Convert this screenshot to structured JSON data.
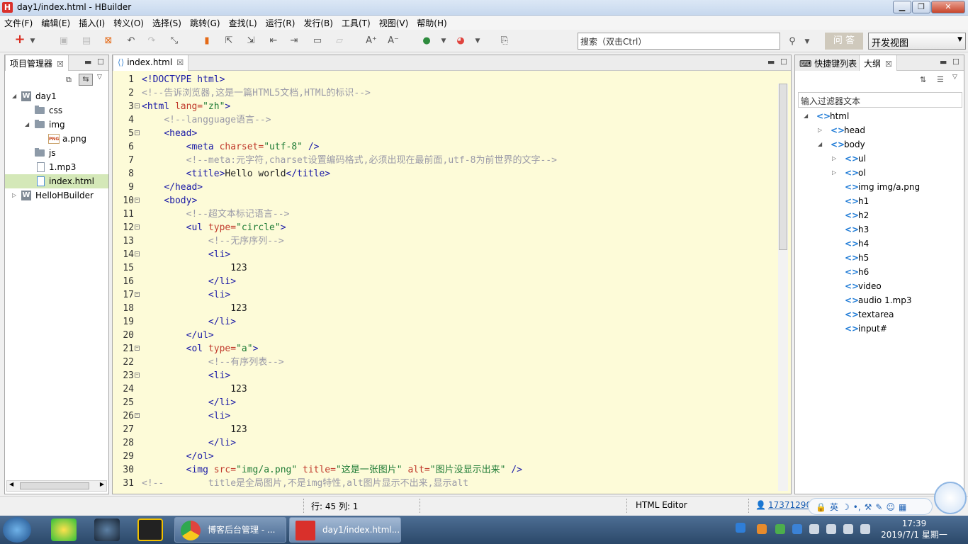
{
  "window": {
    "title": "day1/index.html  - HBuilder",
    "app_icon": "H"
  },
  "menu": [
    "文件(F)",
    "编辑(E)",
    "插入(I)",
    "转义(O)",
    "选择(S)",
    "跳转(G)",
    "查找(L)",
    "运行(R)",
    "发行(B)",
    "工具(T)",
    "视图(V)",
    "帮助(H)"
  ],
  "toolbar": {
    "search_placeholder": "搜索（双击Ctrl）",
    "ask_label": "问 答",
    "view_select": "开发视图"
  },
  "project_panel": {
    "tab": "项目管理器",
    "tree": [
      {
        "label": "day1",
        "type": "project",
        "depth": 0,
        "expanded": true
      },
      {
        "label": "css",
        "type": "folder",
        "depth": 1
      },
      {
        "label": "img",
        "type": "folder",
        "depth": 1,
        "expanded": true
      },
      {
        "label": "a.png",
        "type": "png",
        "depth": 2
      },
      {
        "label": "js",
        "type": "folder",
        "depth": 1
      },
      {
        "label": "1.mp3",
        "type": "file",
        "depth": 1
      },
      {
        "label": "index.html",
        "type": "html",
        "depth": 1,
        "selected": true
      },
      {
        "label": "HelloHBuilder",
        "type": "project",
        "depth": 0,
        "collapsed": true
      }
    ]
  },
  "editor": {
    "tab": "index.html",
    "lines": [
      {
        "n": "1",
        "tokens": [
          {
            "t": "tag",
            "v": "<!DOCTYPE html>"
          }
        ]
      },
      {
        "n": "2",
        "tokens": [
          {
            "t": "cmt",
            "v": "<!--告诉浏览器,这是一篇HTML5文档,HTML的标识-->"
          }
        ]
      },
      {
        "n": "3",
        "fold": true,
        "tokens": [
          {
            "t": "tag",
            "v": "<html "
          },
          {
            "t": "attr",
            "v": "lang="
          },
          {
            "t": "val",
            "v": "\"zh\""
          },
          {
            "t": "tag",
            "v": ">"
          }
        ]
      },
      {
        "n": "4",
        "tokens": [
          {
            "t": "txt",
            "v": "    "
          },
          {
            "t": "cmt",
            "v": "<!--langguage语言-->"
          }
        ]
      },
      {
        "n": "5",
        "fold": true,
        "tokens": [
          {
            "t": "txt",
            "v": "    "
          },
          {
            "t": "tag",
            "v": "<head>"
          }
        ]
      },
      {
        "n": "6",
        "tokens": [
          {
            "t": "txt",
            "v": "        "
          },
          {
            "t": "tag",
            "v": "<meta "
          },
          {
            "t": "attr",
            "v": "charset="
          },
          {
            "t": "val",
            "v": "\"utf-8\""
          },
          {
            "t": "tag",
            "v": " />"
          }
        ]
      },
      {
        "n": "7",
        "tokens": [
          {
            "t": "txt",
            "v": "        "
          },
          {
            "t": "cmt",
            "v": "<!--meta:元字符,charset设置编码格式,必须出现在最前面,utf-8为前世界的文字-->"
          }
        ]
      },
      {
        "n": "8",
        "tokens": [
          {
            "t": "txt",
            "v": "        "
          },
          {
            "t": "tag",
            "v": "<title>"
          },
          {
            "t": "txt",
            "v": "Hello world"
          },
          {
            "t": "tag",
            "v": "</title>"
          }
        ]
      },
      {
        "n": "9",
        "tokens": [
          {
            "t": "txt",
            "v": "    "
          },
          {
            "t": "tag",
            "v": "</head>"
          }
        ]
      },
      {
        "n": "10",
        "fold": true,
        "tokens": [
          {
            "t": "txt",
            "v": "    "
          },
          {
            "t": "tag",
            "v": "<body>"
          }
        ]
      },
      {
        "n": "11",
        "tokens": [
          {
            "t": "txt",
            "v": "        "
          },
          {
            "t": "cmt",
            "v": "<!--超文本标记语言-->"
          }
        ]
      },
      {
        "n": "12",
        "fold": true,
        "tokens": [
          {
            "t": "txt",
            "v": "        "
          },
          {
            "t": "tag",
            "v": "<ul "
          },
          {
            "t": "attr",
            "v": "type="
          },
          {
            "t": "val",
            "v": "\"circle\""
          },
          {
            "t": "tag",
            "v": ">"
          }
        ]
      },
      {
        "n": "13",
        "tokens": [
          {
            "t": "txt",
            "v": "            "
          },
          {
            "t": "cmt",
            "v": "<!--无序序列-->"
          }
        ]
      },
      {
        "n": "14",
        "fold": true,
        "tokens": [
          {
            "t": "txt",
            "v": "            "
          },
          {
            "t": "tag",
            "v": "<li>"
          }
        ]
      },
      {
        "n": "15",
        "tokens": [
          {
            "t": "txt",
            "v": "                123"
          }
        ]
      },
      {
        "n": "16",
        "tokens": [
          {
            "t": "txt",
            "v": "            "
          },
          {
            "t": "tag",
            "v": "</li>"
          }
        ]
      },
      {
        "n": "17",
        "fold": true,
        "tokens": [
          {
            "t": "txt",
            "v": "            "
          },
          {
            "t": "tag",
            "v": "<li>"
          }
        ]
      },
      {
        "n": "18",
        "tokens": [
          {
            "t": "txt",
            "v": "                123"
          }
        ]
      },
      {
        "n": "19",
        "tokens": [
          {
            "t": "txt",
            "v": "            "
          },
          {
            "t": "tag",
            "v": "</li>"
          }
        ]
      },
      {
        "n": "20",
        "tokens": [
          {
            "t": "txt",
            "v": "        "
          },
          {
            "t": "tag",
            "v": "</ul>"
          }
        ]
      },
      {
        "n": "21",
        "fold": true,
        "tokens": [
          {
            "t": "txt",
            "v": "        "
          },
          {
            "t": "tag",
            "v": "<ol "
          },
          {
            "t": "attr",
            "v": "type="
          },
          {
            "t": "val",
            "v": "\"a\""
          },
          {
            "t": "tag",
            "v": ">"
          }
        ]
      },
      {
        "n": "22",
        "tokens": [
          {
            "t": "txt",
            "v": "            "
          },
          {
            "t": "cmt",
            "v": "<!--有序列表-->"
          }
        ]
      },
      {
        "n": "23",
        "fold": true,
        "tokens": [
          {
            "t": "txt",
            "v": "            "
          },
          {
            "t": "tag",
            "v": "<li>"
          }
        ]
      },
      {
        "n": "24",
        "tokens": [
          {
            "t": "txt",
            "v": "                123"
          }
        ]
      },
      {
        "n": "25",
        "tokens": [
          {
            "t": "txt",
            "v": "            "
          },
          {
            "t": "tag",
            "v": "</li>"
          }
        ]
      },
      {
        "n": "26",
        "fold": true,
        "tokens": [
          {
            "t": "txt",
            "v": "            "
          },
          {
            "t": "tag",
            "v": "<li>"
          }
        ]
      },
      {
        "n": "27",
        "tokens": [
          {
            "t": "txt",
            "v": "                123"
          }
        ]
      },
      {
        "n": "28",
        "tokens": [
          {
            "t": "txt",
            "v": "            "
          },
          {
            "t": "tag",
            "v": "</li>"
          }
        ]
      },
      {
        "n": "29",
        "tokens": [
          {
            "t": "txt",
            "v": "        "
          },
          {
            "t": "tag",
            "v": "</ol>"
          }
        ]
      },
      {
        "n": "30",
        "tokens": [
          {
            "t": "txt",
            "v": "        "
          },
          {
            "t": "tag",
            "v": "<img "
          },
          {
            "t": "attr",
            "v": "src="
          },
          {
            "t": "val",
            "v": "\"img/a.png\""
          },
          {
            "t": "attr",
            "v": " title="
          },
          {
            "t": "val",
            "v": "\"这是一张图片\""
          },
          {
            "t": "attr",
            "v": " alt="
          },
          {
            "t": "val",
            "v": "\"图片没显示出来\""
          },
          {
            "t": "tag",
            "v": " />"
          }
        ]
      },
      {
        "n": "31",
        "tokens": [
          {
            "t": "cmt",
            "v": "<!--        title是全局图片,不是img特性,alt图片显示不出来,显示alt"
          }
        ]
      }
    ]
  },
  "outline_panel": {
    "tab_shortcuts": "快捷键列表",
    "tab_outline": "大纲",
    "filter_placeholder": "输入过滤器文本",
    "nodes": [
      {
        "label": "html",
        "depth": 0,
        "tri": "expanded"
      },
      {
        "label": "head",
        "depth": 1,
        "tri": "collapsed"
      },
      {
        "label": "body",
        "depth": 1,
        "tri": "expanded"
      },
      {
        "label": "ul",
        "depth": 2,
        "tri": "collapsed"
      },
      {
        "label": "ol",
        "depth": 2,
        "tri": "collapsed"
      },
      {
        "label": "img img/a.png",
        "depth": 2
      },
      {
        "label": "h1",
        "depth": 2
      },
      {
        "label": "h2",
        "depth": 2
      },
      {
        "label": "h3",
        "depth": 2
      },
      {
        "label": "h4",
        "depth": 2
      },
      {
        "label": "h5",
        "depth": 2
      },
      {
        "label": "h6",
        "depth": 2
      },
      {
        "label": "video",
        "depth": 2
      },
      {
        "label": "audio 1.mp3",
        "depth": 2
      },
      {
        "label": "textarea",
        "depth": 2
      },
      {
        "label": "input#",
        "depth": 2
      }
    ]
  },
  "status": {
    "position": "行: 45 列: 1",
    "editor_type": "HTML Editor",
    "user": "17371290"
  },
  "ime": {
    "items": [
      "英",
      "☽",
      "•,",
      "⚒",
      "✎",
      "☺",
      "▦"
    ]
  },
  "taskbar": {
    "buttons": [
      {
        "label": "博客后台管理 - ..."
      },
      {
        "label": "day1/index.html..."
      }
    ],
    "time": "17:39",
    "date": "2019/7/1 星期一"
  },
  "colors": {
    "editor_bg": "#fdfbd8",
    "tag": "#1a1aa6",
    "attr": "#c0392b",
    "value": "#1e7b35",
    "comment": "#9a9aa8",
    "selected_row": "#d4e8b8"
  }
}
